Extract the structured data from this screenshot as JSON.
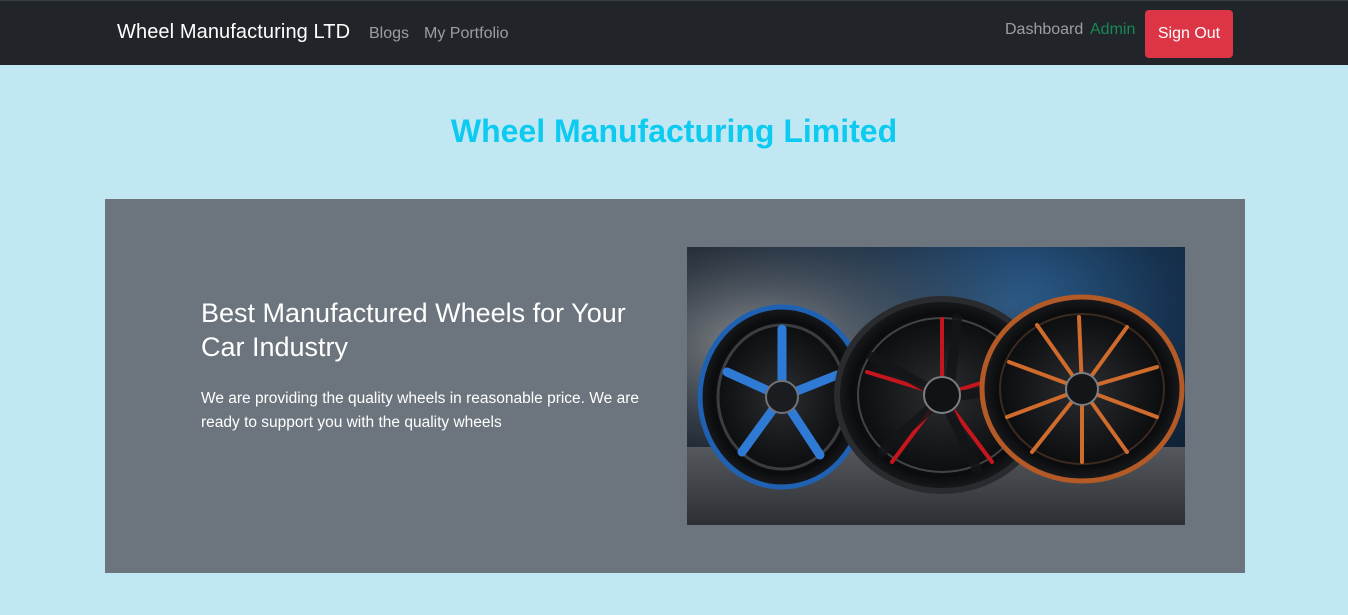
{
  "navbar": {
    "brand": "Wheel Manufacturing LTD",
    "links": [
      "Blogs",
      "My Portfolio"
    ],
    "dashboard_label": "Dashboard",
    "user_role": "Admin",
    "signout_label": "Sign Out"
  },
  "main": {
    "heading": "Wheel Manufacturing Limited",
    "hero": {
      "title": "Best Manufactured Wheels for Your Car Industry",
      "text": "We are providing the quality wheels in reasonable price. We are ready to support you with the quality wheels"
    }
  },
  "colors": {
    "navbar_bg": "#212529",
    "page_bg": "#c1e8f2",
    "heading": "#0dcaf0",
    "hero_bg": "#6c757d",
    "admin": "#198754",
    "signout": "#dc3545"
  }
}
